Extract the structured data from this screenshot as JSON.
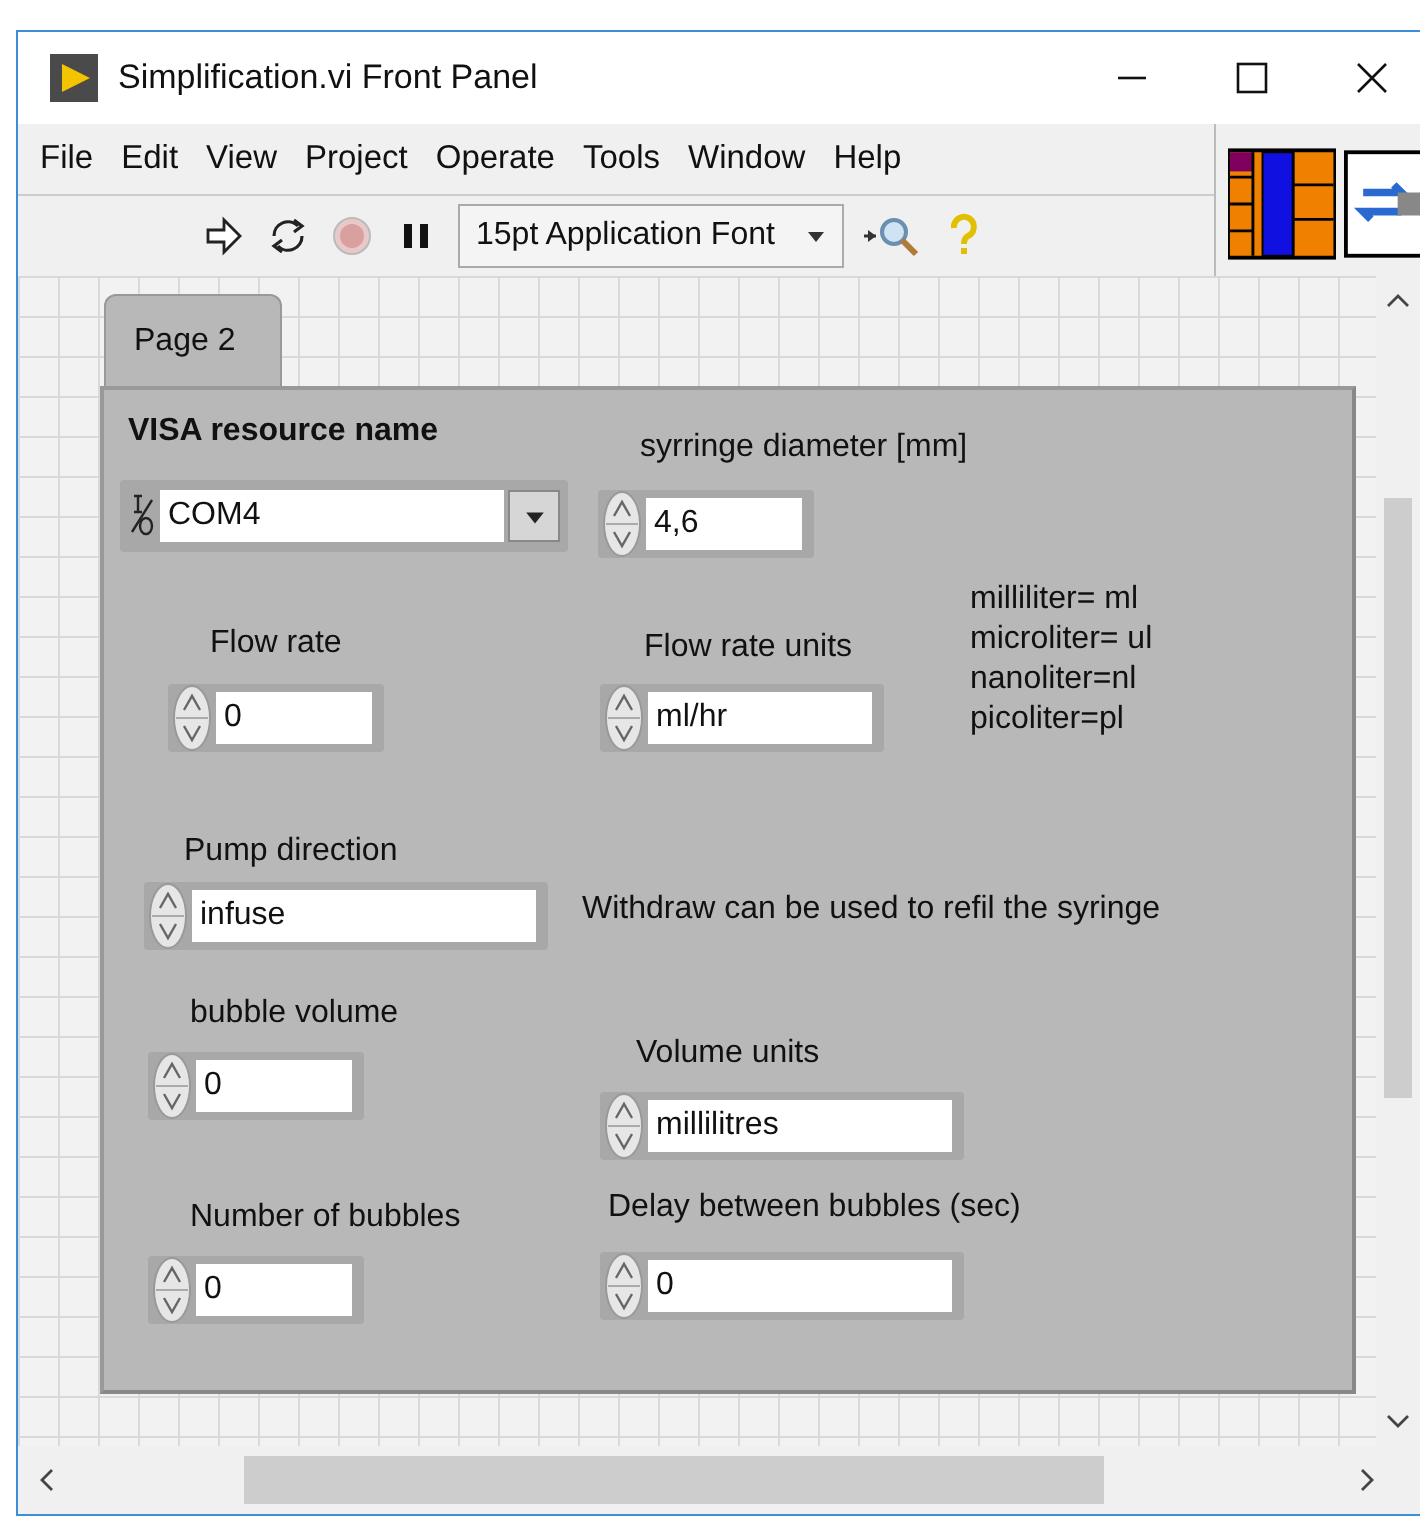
{
  "window": {
    "title": "Simplification.vi Front Panel"
  },
  "menu": [
    "File",
    "Edit",
    "View",
    "Project",
    "Operate",
    "Tools",
    "Window",
    "Help"
  ],
  "toolbar": {
    "font": "15pt Application Font"
  },
  "tabs": [
    {
      "label": "Page 2",
      "selected": true
    }
  ],
  "controls": [
    {
      "kind": "visa",
      "label": "VISA resource name",
      "value": "COM4"
    },
    {
      "kind": "numeric",
      "label": "syrringe diameter [mm]",
      "value": "4,6"
    },
    {
      "kind": "numeric",
      "label": "Flow rate",
      "value": "0"
    },
    {
      "kind": "ring",
      "label": "Flow rate units",
      "value": "ml/hr"
    },
    {
      "kind": "ring",
      "label": "Pump direction",
      "value": "infuse"
    },
    {
      "kind": "numeric",
      "label": "bubble volume",
      "value": "0"
    },
    {
      "kind": "ring",
      "label": "Volume units",
      "value": "millilitres"
    },
    {
      "kind": "numeric",
      "label": "Number of bubbles",
      "value": "0"
    },
    {
      "kind": "numeric",
      "label": "Delay between bubbles (sec)",
      "value": "0"
    }
  ],
  "notes": [
    {
      "lines": [
        "milliliter= ml",
        "microliter= ul",
        "nanoliter=nl",
        "picoliter=pl"
      ]
    },
    {
      "lines": [
        "Withdraw can be used to refil the syringe"
      ]
    }
  ]
}
